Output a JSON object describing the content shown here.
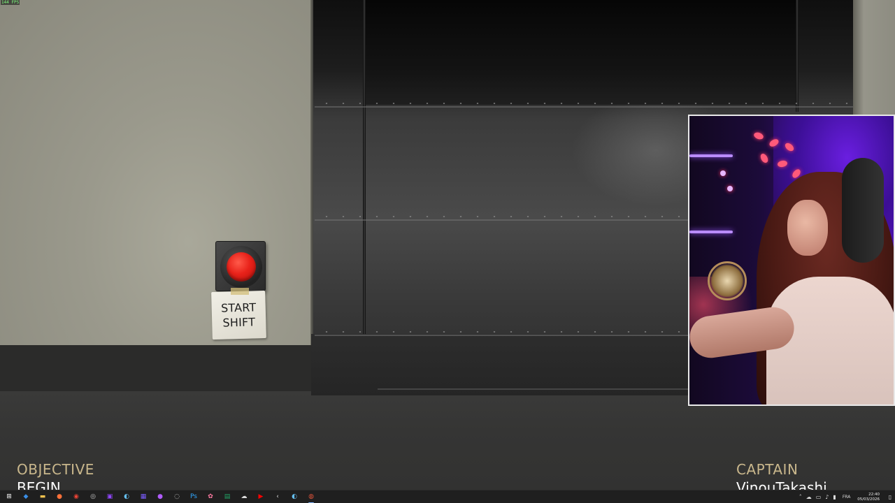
{
  "overlay": {
    "fps": "144 FPS"
  },
  "scene": {
    "button_note": "START\nSHIFT"
  },
  "hud": {
    "objective_label": "OBJECTIVE",
    "objective_value": "BEGIN",
    "captain_label": "CAPTAIN",
    "captain_value": "VinouTakashi"
  },
  "colors": {
    "hud_label": "#c9b78c",
    "button_red": "#e8221a",
    "webcam_accent": "#6a1ee0"
  },
  "taskbar": {
    "apps": [
      {
        "name": "start",
        "icon": "windows-icon",
        "glyph": "⊞",
        "color": "#ffffff"
      },
      {
        "name": "explorer-shortcut",
        "icon": "blue-app-icon",
        "glyph": "◆",
        "color": "#3a8ee6"
      },
      {
        "name": "file-explorer",
        "icon": "folder-icon",
        "glyph": "▬",
        "color": "#f2c14e"
      },
      {
        "name": "firefox",
        "icon": "firefox-icon",
        "glyph": "●",
        "color": "#ff7139"
      },
      {
        "name": "chrome",
        "icon": "chrome-icon",
        "glyph": "◉",
        "color": "#ea4335"
      },
      {
        "name": "app-5",
        "icon": "globe-icon",
        "glyph": "◎",
        "color": "#cccccc"
      },
      {
        "name": "twitch",
        "icon": "twitch-icon",
        "glyph": "▣",
        "color": "#9146ff"
      },
      {
        "name": "steam",
        "icon": "steam-icon",
        "glyph": "◐",
        "color": "#66c0f4"
      },
      {
        "name": "app-8",
        "icon": "grid-icon",
        "glyph": "▦",
        "color": "#7b5cff"
      },
      {
        "name": "app-9",
        "icon": "purple-circle-icon",
        "glyph": "●",
        "color": "#b15cff"
      },
      {
        "name": "app-10",
        "icon": "elgato-icon",
        "glyph": "◌",
        "color": "#cccccc"
      },
      {
        "name": "photoshop",
        "icon": "photoshop-icon",
        "glyph": "Ps",
        "color": "#31a8ff"
      },
      {
        "name": "app-12",
        "icon": "flower-icon",
        "glyph": "✿",
        "color": "#ff7aa2"
      },
      {
        "name": "excel",
        "icon": "spreadsheet-icon",
        "glyph": "▤",
        "color": "#21a366"
      },
      {
        "name": "app-14",
        "icon": "cloud-icon",
        "glyph": "☁",
        "color": "#dddddd"
      },
      {
        "name": "youtube",
        "icon": "youtube-icon",
        "glyph": "▶",
        "color": "#ff0000"
      },
      {
        "name": "app-16",
        "icon": "chevron-icon",
        "glyph": "‹",
        "color": "#dddddd"
      },
      {
        "name": "steam-2",
        "icon": "steam-icon",
        "glyph": "◐",
        "color": "#66c0f4"
      },
      {
        "name": "game-active",
        "icon": "game-icon",
        "glyph": "◍",
        "color": "#e0533a"
      }
    ],
    "tray": {
      "lang": "FRA",
      "time": "22:40",
      "date": "05/03/2026"
    }
  }
}
